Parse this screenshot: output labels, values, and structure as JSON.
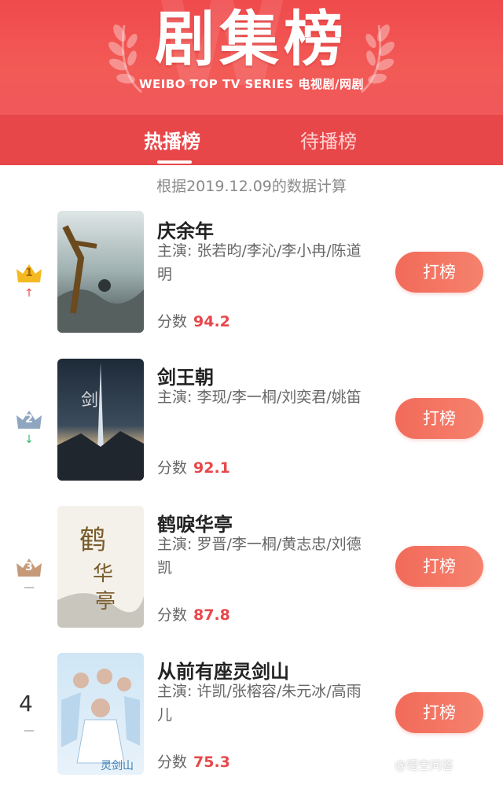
{
  "header": {
    "title": "剧集榜",
    "subtitle": "WEIBO TOP TV SERIES 电视剧/网剧",
    "colors": {
      "banner": "#f04a4c",
      "accent": "#e8474a"
    }
  },
  "tabs": [
    {
      "label": "热播榜",
      "active": true
    },
    {
      "label": "待播榜",
      "active": false
    }
  ],
  "notice": "根据2019.12.09的数据计算",
  "list": [
    {
      "rank": "1",
      "trend": "up",
      "trend_glyph": "↑",
      "name": "庆余年",
      "cast": "主演: 张若昀/李沁/李小冉/陈道明",
      "score_label": "分数",
      "score": "94.2",
      "vote_label": "打榜"
    },
    {
      "rank": "2",
      "trend": "down",
      "trend_glyph": "↓",
      "name": "剑王朝",
      "cast": "主演: 李现/李一桐/刘奕君/姚笛",
      "score_label": "分数",
      "score": "92.1",
      "vote_label": "打榜"
    },
    {
      "rank": "3",
      "trend": "flat",
      "trend_glyph": "—",
      "name": "鹤唳华亭",
      "cast": "主演: 罗晋/李一桐/黄志忠/刘德凯",
      "score_label": "分数",
      "score": "87.8",
      "vote_label": "打榜"
    },
    {
      "rank": "4",
      "trend": "flat",
      "trend_glyph": "—",
      "name": "从前有座灵剑山",
      "cast": "主演: 许凯/张榕容/朱元冰/高雨儿",
      "score_label": "分数",
      "score": "75.3",
      "vote_label": "打榜"
    }
  ],
  "watermark": "@悟空问答"
}
